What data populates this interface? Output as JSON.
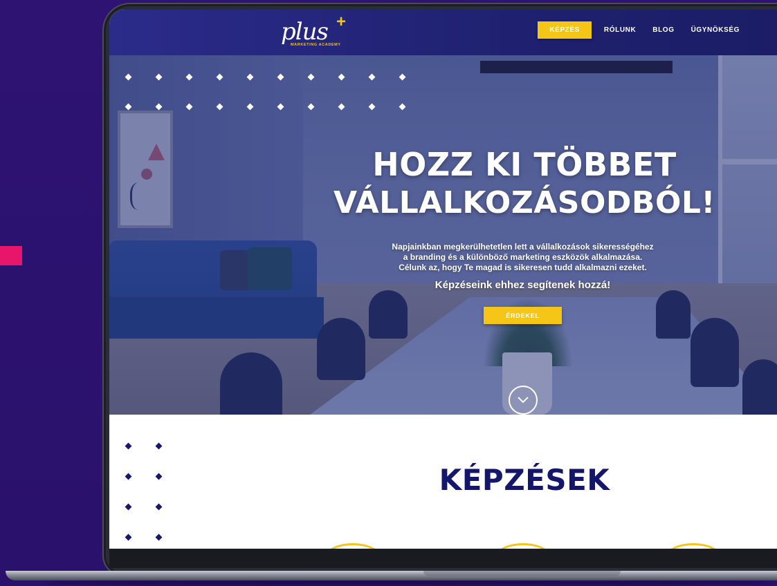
{
  "brand": {
    "logo_text": "plus",
    "logo_plus": "+",
    "logo_sub": "MARKETING ACADEMY",
    "accent_color": "#f5c518",
    "navy_color": "#14166b",
    "background_color": "#2c1270",
    "pink_color": "#e8166a"
  },
  "nav": {
    "items": [
      {
        "label": "KÉPZÉS",
        "active": true
      },
      {
        "label": "RÓLUNK",
        "active": false
      },
      {
        "label": "BLOG",
        "active": false
      },
      {
        "label": "ÜGYNÖKSÉG",
        "active": false
      }
    ]
  },
  "hero": {
    "title_line1": "HOZZ KI TÖBBET",
    "title_line2": "VÁLLALKOZÁSODBÓL!",
    "description_line1": "Napjainkban megkerülhetetlen lett a vállalkozások sikerességéhez",
    "description_line2": "a branding és a különböző marketing eszközök alkalmazása.",
    "description_line3": "Célunk az, hogy Te magad is sikeresen tudd alkalmazni ezeket.",
    "subtitle": "Képzéseink ehhez segítenek hozzá!",
    "cta_label": "ÉRDEKEL",
    "scroll_icon": "chevron-down-icon"
  },
  "courses": {
    "title": "KÉPZÉSEK"
  }
}
